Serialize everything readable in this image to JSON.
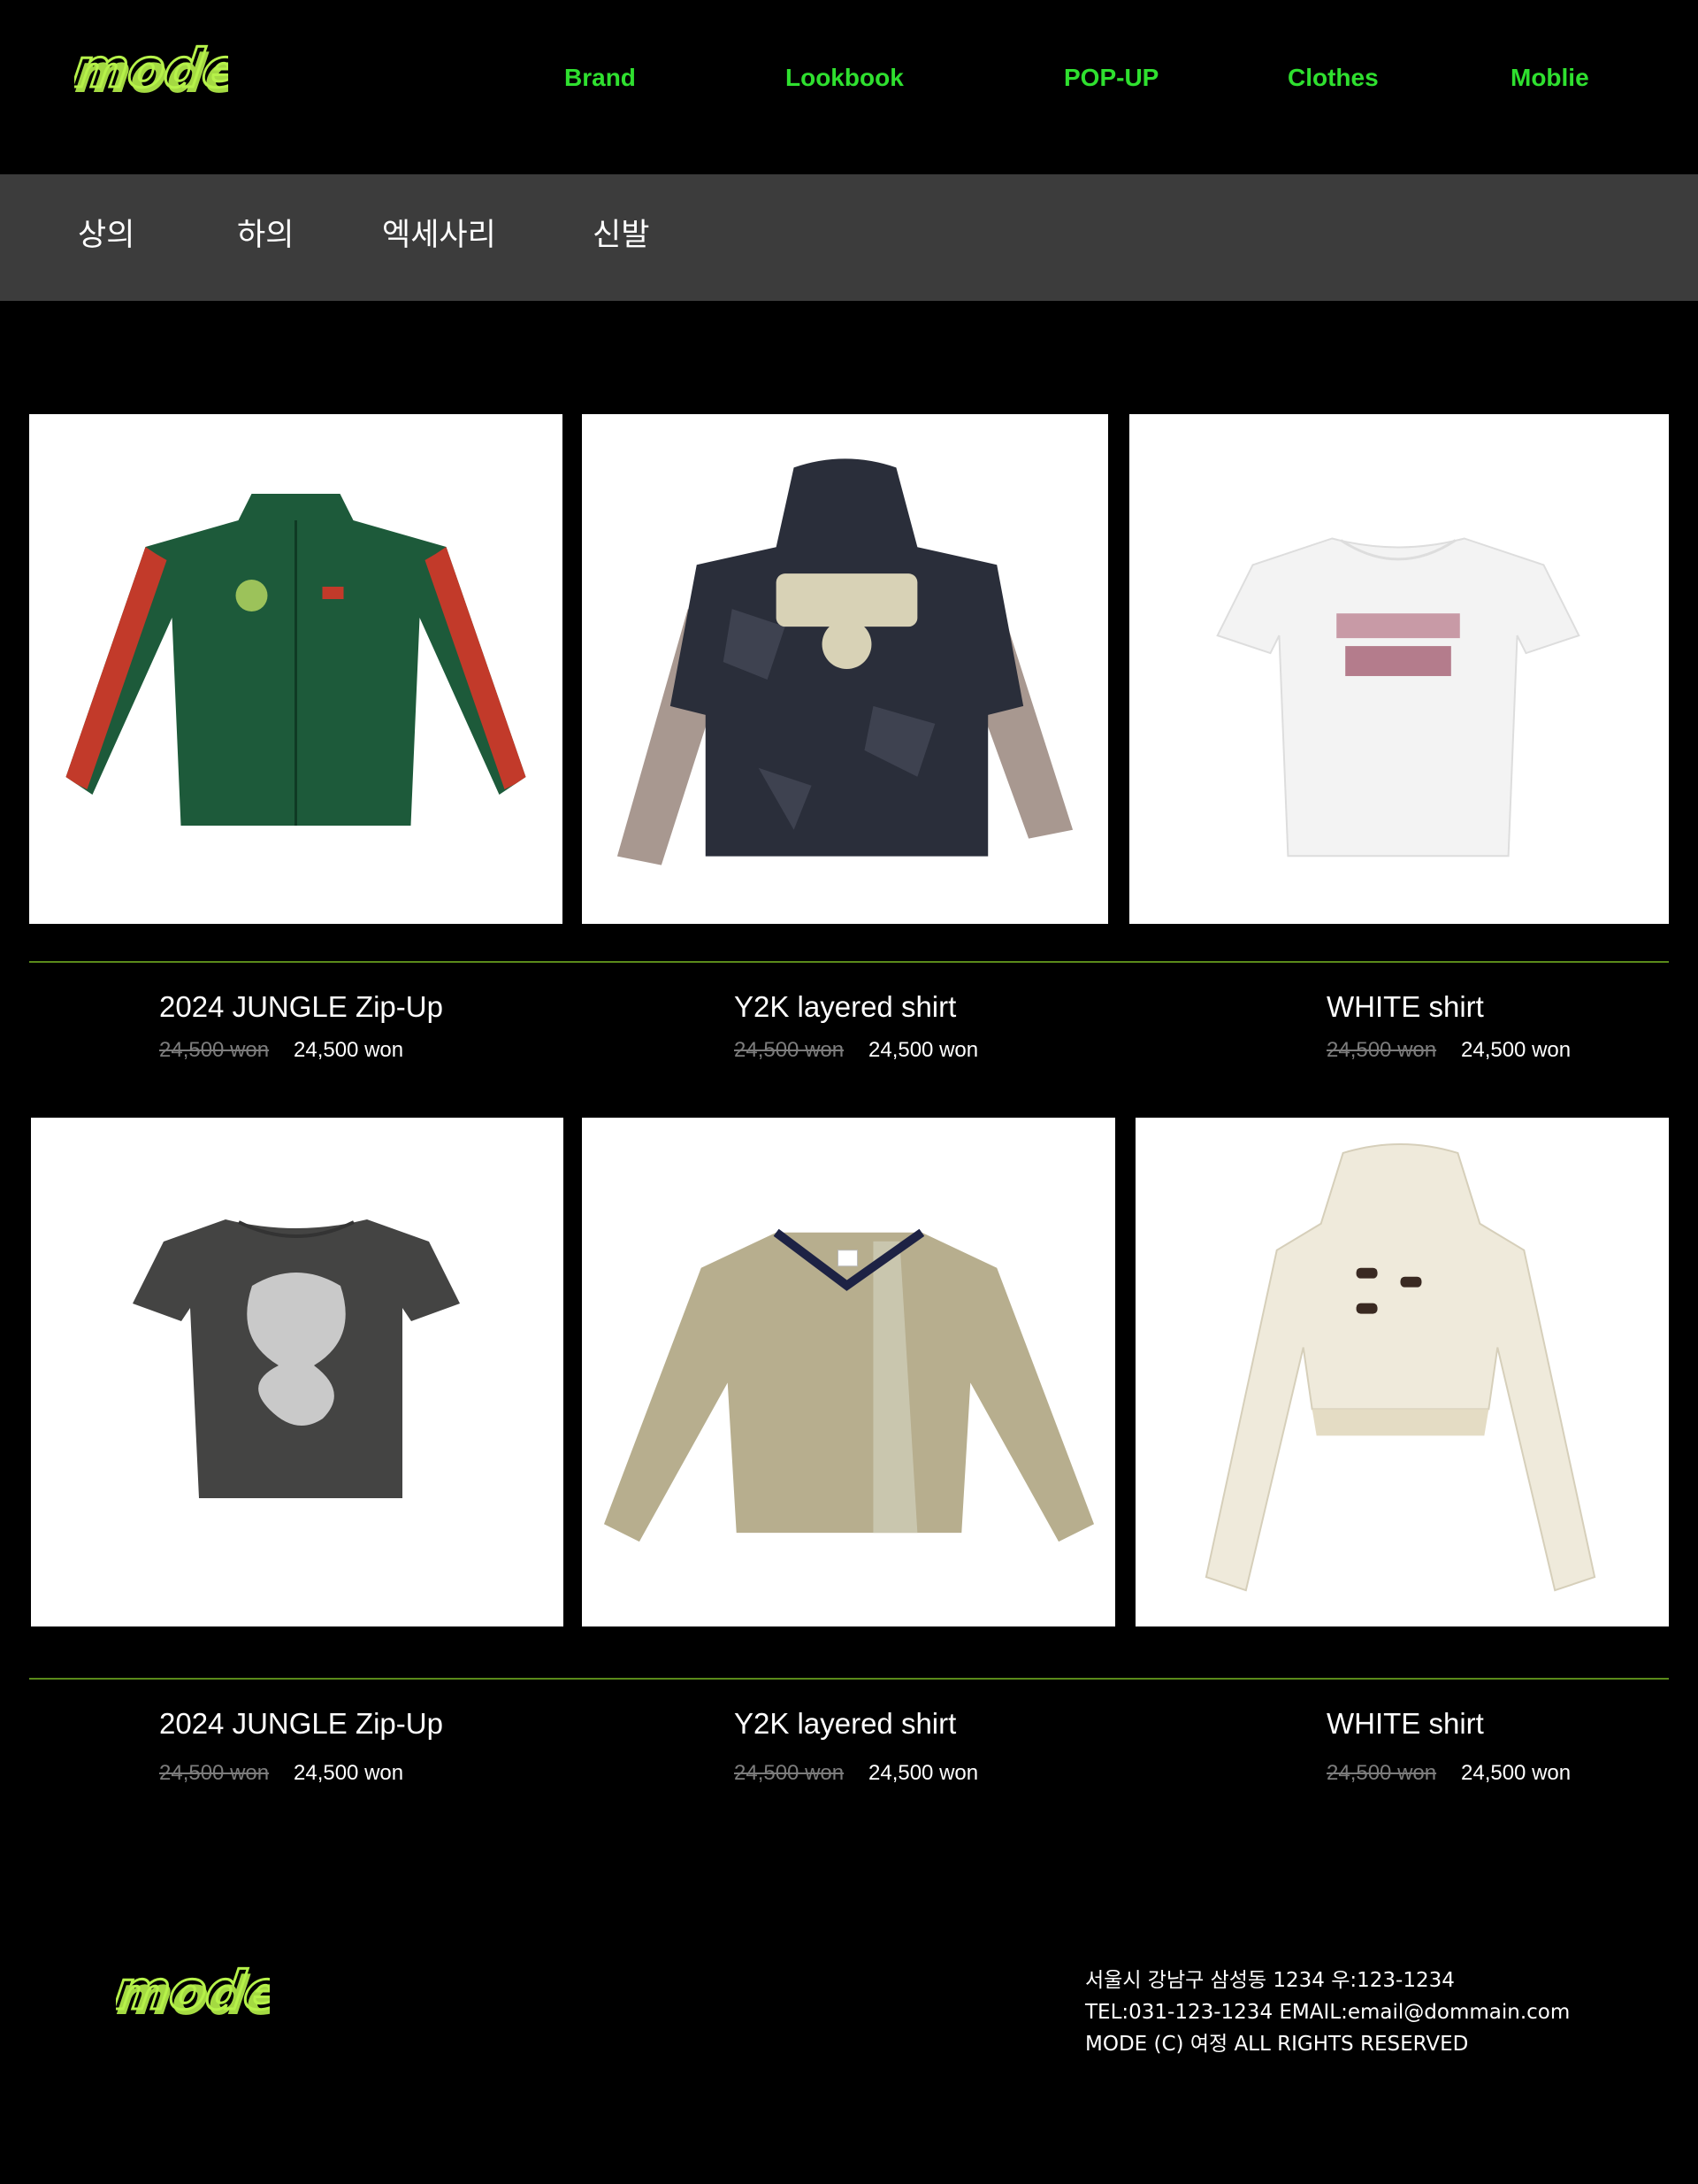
{
  "header": {
    "logo_text": "mode",
    "nav": [
      "Brand",
      "Lookbook",
      "POP-UP",
      "Clothes",
      "Moblie"
    ]
  },
  "categories": [
    "상의",
    "하의",
    "엑세사리",
    "신발"
  ],
  "products": [
    {
      "name": "2024 JUNGLE Zip-Up",
      "old_price": "24,500 won",
      "price": "24,500 won",
      "image": "green-track-jacket"
    },
    {
      "name": "Y2K layered shirt",
      "old_price": "24,500 won",
      "price": "24,500 won",
      "image": "camo-layered-hoodie"
    },
    {
      "name": "WHITE shirt",
      "old_price": "24,500 won",
      "price": "24,500 won",
      "image": "white-tshirt"
    },
    {
      "name": "2024 JUNGLE Zip-Up",
      "old_price": "24,500 won",
      "price": "24,500 won",
      "image": "charcoal-tshirt"
    },
    {
      "name": "Y2K layered shirt",
      "old_price": "24,500 won",
      "price": "24,500 won",
      "image": "beige-pullover"
    },
    {
      "name": "WHITE shirt",
      "old_price": "24,500 won",
      "price": "24,500 won",
      "image": "cream-knit-hoodie"
    }
  ],
  "footer": {
    "address": "서울시 강남구 삼성동 1234 우:123-1234",
    "contact": "TEL:031-123-1234 EMAIL:email@dommain.com",
    "copyright": "MODE (C) 여정 ALL RIGHTS RESERVED"
  },
  "colors": {
    "nav_green": "#2fe02f",
    "logo_green": "#b6f24a",
    "category_bar": "#3c3c3c",
    "divider": "#5a8a1a",
    "strike_price": "#7c7c7c"
  }
}
